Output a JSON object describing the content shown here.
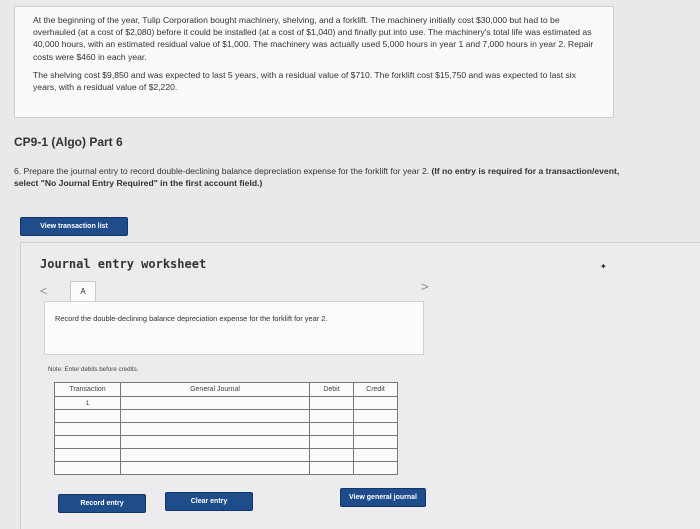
{
  "problem": {
    "para1": "At the beginning of the year, Tulip Corporation bought machinery, shelving, and a forklift. The machinery initially cost $30,000 but had to be overhauled (at a cost of $2,080) before it could be installed (at a cost of $1,040) and finally put into use. The machinery's total life was estimated as 40,000 hours, with an estimated residual value of $1,000. The machinery was actually used 5,000 hours in year 1 and 7,000 hours in year 2. Repair costs were $460 in each year.",
    "para2": "The shelving cost $9,850 and was expected to last 5 years, with a residual value of $710. The forklift cost $15,750 and was expected to last six years, with a residual value of $2,220."
  },
  "part_title": "CP9-1 (Algo) Part 6",
  "question": {
    "text": "6. Prepare the journal entry to record double-declining balance depreciation expense for the forklift for year 2.",
    "bold": "(If no entry is required for a transaction/event, select \"No Journal Entry Required\" in the first account field.)"
  },
  "buttons": {
    "view_transaction_list": "View transaction list",
    "record_entry": "Record entry",
    "clear_entry": "Clear entry",
    "view_general_journal": "View general journal"
  },
  "worksheet": {
    "title": "Journal entry worksheet",
    "nav_prev": "<",
    "nav_next": ">",
    "tab_label": "A",
    "prompt": "Record the double-declining balance depreciation expense for the forklift for year 2.",
    "note": "Note: Enter debits before credits."
  },
  "journal": {
    "headers": [
      "Transaction",
      "General Journal",
      "Debit",
      "Credit"
    ],
    "rows": [
      "1",
      "",
      "",
      "",
      "",
      ""
    ]
  }
}
